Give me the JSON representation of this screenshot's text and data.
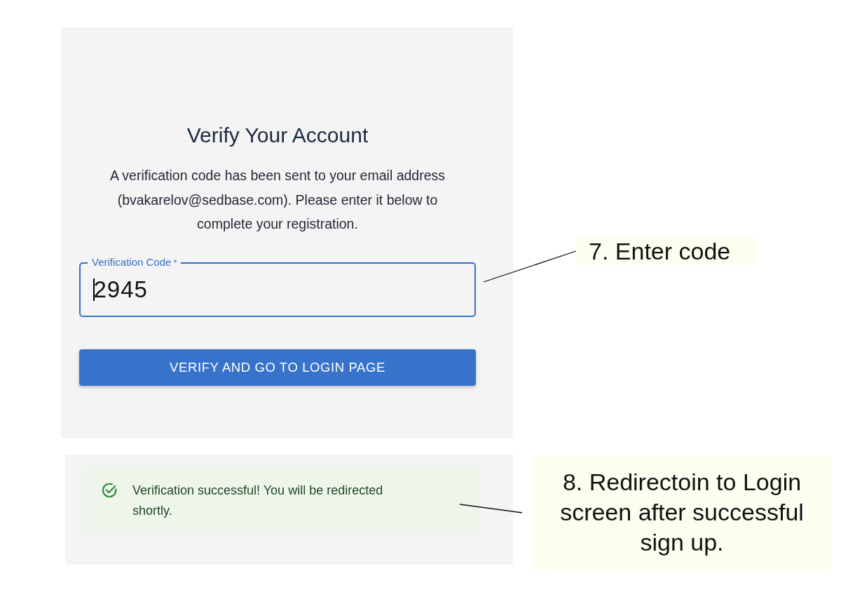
{
  "verify_card": {
    "title": "Verify Your Account",
    "description": "A verification code has been sent to your email address (bvakarelov@sedbase.com). Please enter it below to complete your registration.",
    "code_field": {
      "label": "Verification Code",
      "required_mark": "*",
      "value": "2945",
      "focused": true
    },
    "button": "VERIFY AND GO TO LOGIN PAGE"
  },
  "status_card": {
    "alert": {
      "kind": "success",
      "message": "Verification successful! You will be redirected shortly."
    }
  },
  "annotations": [
    {
      "text": "7. Enter code",
      "leader_line": true
    },
    {
      "text": "8.  Redirectoin to Login screen after successful sign up.",
      "leader_line": true
    }
  ]
}
